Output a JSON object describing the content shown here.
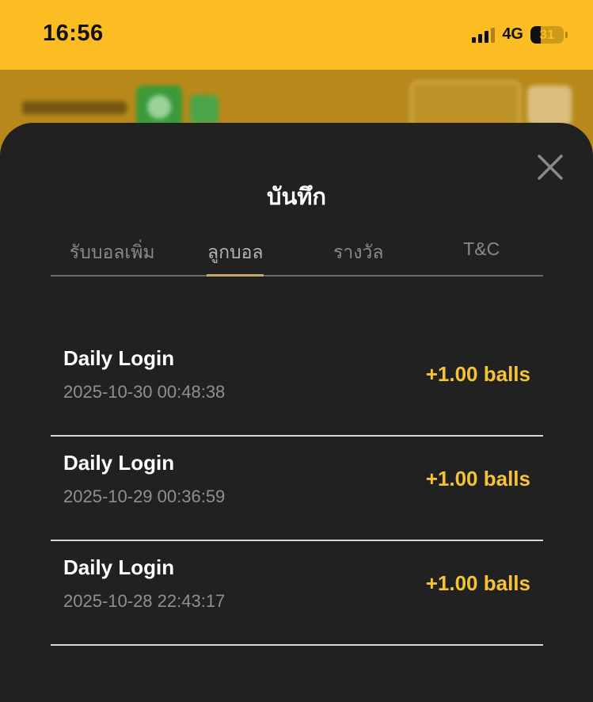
{
  "status_bar": {
    "time": "16:56",
    "network": "4G",
    "battery_level": "31",
    "battery_fraction": 0.31,
    "signal_bars_active": 3,
    "signal_bars_total": 4
  },
  "colors": {
    "accent_yellow": "#fbbd22",
    "sheet_background": "#222122",
    "amount_color": "#f6c335",
    "tab_indicator": "#c9a766"
  },
  "sheet": {
    "title": "บันทึก",
    "close_icon": "close-icon",
    "tabs": [
      {
        "label": "รับบอลเพิ่ม",
        "active": false
      },
      {
        "label": "ลูกบอล",
        "active": true
      },
      {
        "label": "รางวัล",
        "active": false
      },
      {
        "label": "T&C",
        "active": false
      }
    ],
    "records": [
      {
        "title": "Daily Login",
        "timestamp": "2025-10-30 00:48:38",
        "amount": "+1.00 balls"
      },
      {
        "title": "Daily Login",
        "timestamp": "2025-10-29 00:36:59",
        "amount": "+1.00 balls"
      },
      {
        "title": "Daily Login",
        "timestamp": "2025-10-28 22:43:17",
        "amount": "+1.00 balls"
      }
    ]
  }
}
